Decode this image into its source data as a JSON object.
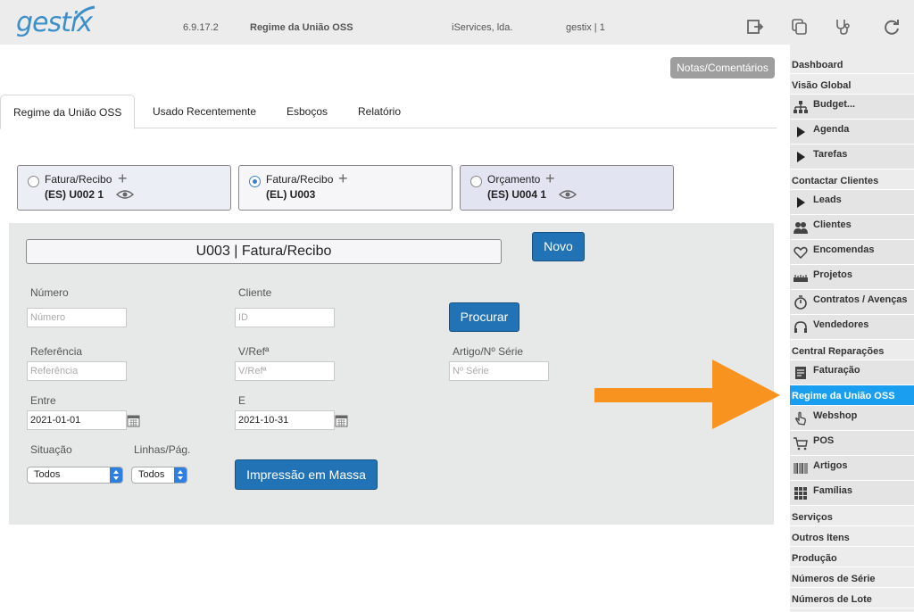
{
  "app": {
    "logo": "gestix",
    "version": "6.9.17.2",
    "module": "Regime da União OSS",
    "company": "iServices, lda.",
    "user": "gestix | 1"
  },
  "toolbar_icons": [
    "logout-icon",
    "copy-icon",
    "stethoscope-icon",
    "refresh-icon"
  ],
  "notes_button": "Notas/Comentários",
  "tabs": [
    "Regime da União OSS",
    "Usado Recentemente",
    "Esboços",
    "Relatório"
  ],
  "cards": [
    {
      "type": "Fatura/Recibo",
      "code": "(ES) U002 1",
      "selected": false
    },
    {
      "type": "Fatura/Recibo",
      "code": "(EL) U003",
      "selected": true
    },
    {
      "type": "Orçamento",
      "code": "(ES) U004 1",
      "selected": false
    }
  ],
  "form": {
    "doc_title": "U003 | Fatura/Recibo",
    "novo": "Novo",
    "numero_label": "Número",
    "numero_placeholder": "Número",
    "cliente_label": "Cliente",
    "cliente_placeholder": "ID",
    "procurar": "Procurar",
    "referencia_label": "Referência",
    "referencia_placeholder": "Referência",
    "vref_label": "V/Refª",
    "vref_placeholder": "V/Refª",
    "artigo_label": "Artigo/Nº Série",
    "artigo_placeholder": "Nº Série",
    "entre_label": "Entre",
    "entre_value": "2021-01-01",
    "e_label": "E",
    "e_value": "2021-10-31",
    "situacao_label": "Situação",
    "situacao_value": "Todos",
    "linhas_label": "Linhas/Pág.",
    "linhas_value": "Todos",
    "impressao": "Impressão em Massa"
  },
  "sidebar": {
    "items": [
      {
        "label": "Dashboard",
        "icon": ""
      },
      {
        "label": "Visão Global",
        "icon": ""
      },
      {
        "label": "Budget...",
        "icon": "org-chart-icon"
      },
      {
        "label": "Agenda",
        "icon": "play-icon"
      },
      {
        "label": "Tarefas",
        "icon": "play-icon"
      },
      {
        "label": "Contactar Clientes",
        "icon": ""
      },
      {
        "label": "Leads",
        "icon": "play-icon"
      },
      {
        "label": "Clientes",
        "icon": "users-icon"
      },
      {
        "label": "Encomendas",
        "icon": "heart-icon"
      },
      {
        "label": "Projetos",
        "icon": "ruler-icon"
      },
      {
        "label": "Contratos / Avenças",
        "icon": "stopwatch-icon"
      },
      {
        "label": "Vendedores",
        "icon": "headset-icon"
      },
      {
        "label": "Central Reparações",
        "icon": ""
      },
      {
        "label": "Faturação",
        "icon": "document-icon"
      },
      {
        "label": "Regime da União OSS",
        "icon": ""
      },
      {
        "label": "Webshop",
        "icon": "hand-pointer-icon"
      },
      {
        "label": "POS",
        "icon": "cart-icon"
      },
      {
        "label": "Artigos",
        "icon": "barcode-icon"
      },
      {
        "label": "Famílias",
        "icon": "grid-icon"
      },
      {
        "label": "Serviços",
        "icon": ""
      },
      {
        "label": "Outros Itens",
        "icon": ""
      },
      {
        "label": "Produção",
        "icon": ""
      },
      {
        "label": "Números de Série",
        "icon": ""
      },
      {
        "label": "Números de Lote",
        "icon": ""
      }
    ]
  },
  "colors": {
    "accent": "#2273b6",
    "sidebar_active": "#1a9ff0",
    "arrow": "#f7931e",
    "logo": "#3d8fc9"
  }
}
